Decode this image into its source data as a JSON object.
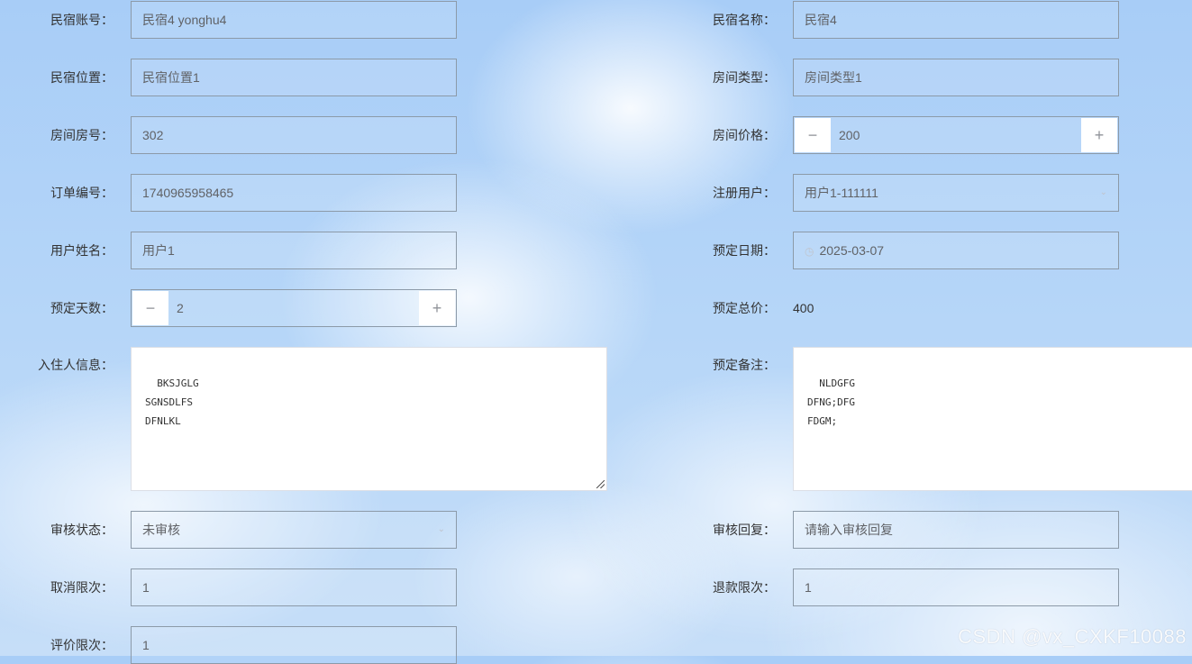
{
  "fields": {
    "homestay_account": {
      "label": "民宿账号：",
      "value": "民宿4 yonghu4"
    },
    "homestay_name": {
      "label": "民宿名称：",
      "value": "民宿4"
    },
    "homestay_location": {
      "label": "民宿位置：",
      "value": "民宿位置1"
    },
    "room_type": {
      "label": "房间类型：",
      "value": "房间类型1"
    },
    "room_number": {
      "label": "房间房号：",
      "value": "302"
    },
    "room_price": {
      "label": "房间价格：",
      "value": "200",
      "minus": "−",
      "plus": "+"
    },
    "order_number": {
      "label": "订单编号：",
      "value": "1740965958465"
    },
    "registered_user": {
      "label": "注册用户：",
      "value": "用户1-111111"
    },
    "user_name": {
      "label": "用户姓名：",
      "value": "用户1"
    },
    "booking_date": {
      "label": "预定日期：",
      "value": "2025-03-07"
    },
    "booking_days": {
      "label": "预定天数：",
      "value": "2",
      "minus": "−",
      "plus": "+"
    },
    "booking_total": {
      "label": "预定总价：",
      "value": "400"
    },
    "guest_info": {
      "label": "入住人信息：",
      "value": "BKSJGLG\nSGNSDLFS\nDFNLKL"
    },
    "booking_remark": {
      "label": "预定备注：",
      "value": "NLDGFG\nDFNG;DFG\nFDGM;"
    },
    "review_status": {
      "label": "审核状态：",
      "value": "未审核"
    },
    "review_reply": {
      "label": "审核回复：",
      "placeholder": "请输入审核回复"
    },
    "cancel_limit": {
      "label": "取消限次：",
      "value": "1"
    },
    "refund_limit": {
      "label": "退款限次：",
      "value": "1"
    },
    "review_limit": {
      "label": "评价限次：",
      "value": "1"
    }
  },
  "watermark": "CSDN @vx_CXKF10088",
  "colors": {
    "border": "#8c9aa8",
    "text": "#333333",
    "input_text": "#606266"
  }
}
